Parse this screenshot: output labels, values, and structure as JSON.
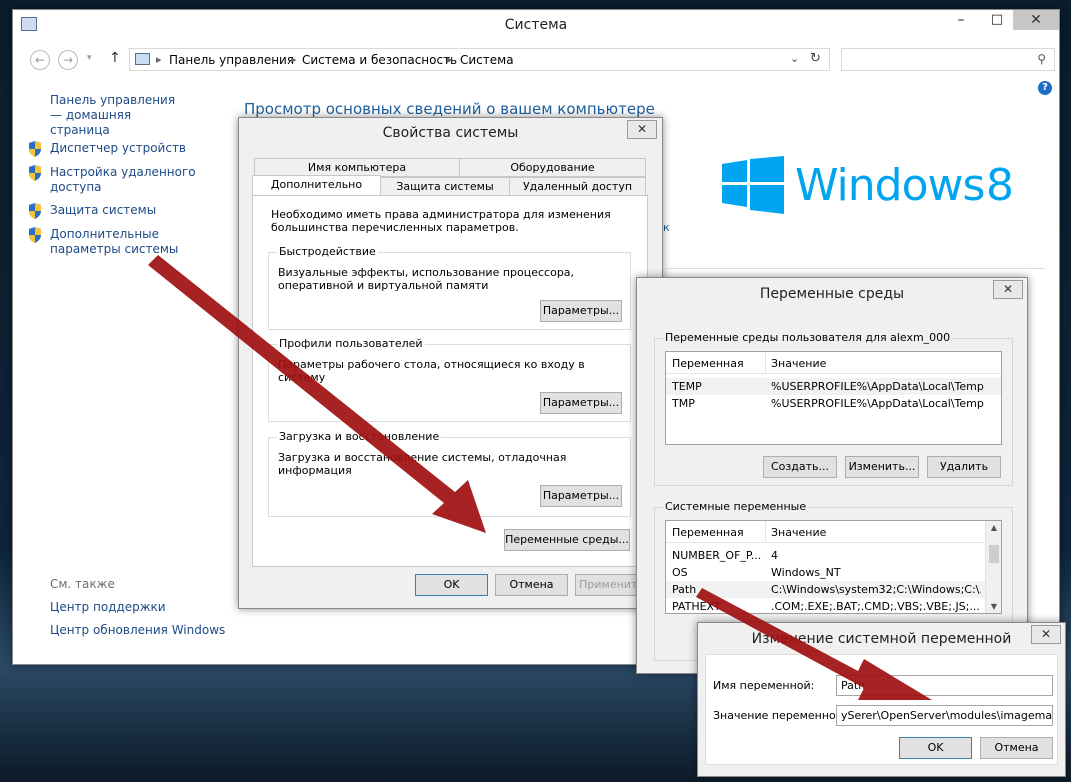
{
  "main_window": {
    "title": "Система",
    "breadcrumb": [
      "Панель управления",
      "Система и безопасность",
      "Система"
    ],
    "search_placeholder": "",
    "heading": "Просмотр основных сведений о вашем компьютере",
    "windows_logo_text": "Windows",
    "windows_version": "8",
    "partial_link": "к",
    "sidebar": {
      "home_link": "Панель управления — домашняя страница",
      "items": [
        {
          "label": "Диспетчер устройств"
        },
        {
          "label": "Настройка удаленного доступа"
        },
        {
          "label": "Защита системы"
        },
        {
          "label": "Дополнительные параметры системы"
        }
      ],
      "see_also_title": "См. также",
      "see_also": [
        "Центр поддержки",
        "Центр обновления Windows"
      ]
    }
  },
  "sys_props": {
    "title": "Свойства системы",
    "tabs_row1": [
      "Имя компьютера",
      "Оборудование"
    ],
    "tabs_row2": [
      "Дополнительно",
      "Защита системы",
      "Удаленный доступ"
    ],
    "admin_note": "Необходимо иметь права администратора для изменения большинства перечисленных параметров.",
    "performance": {
      "title": "Быстродействие",
      "desc": "Визуальные эффекты, использование процессора, оперативной и виртуальной памяти",
      "button": "Параметры..."
    },
    "profiles": {
      "title": "Профили пользователей",
      "desc": "Параметры рабочего стола, относящиеся ко входу в систему",
      "button": "Параметры..."
    },
    "startup": {
      "title": "Загрузка и восстановление",
      "desc": "Загрузка и восстановление системы, отладочная информация",
      "button": "Параметры..."
    },
    "env_button": "Переменные среды...",
    "ok": "OK",
    "cancel": "Отмена",
    "apply": "Применить"
  },
  "env_vars": {
    "title": "Переменные среды",
    "user_group_title": "Переменные среды пользователя для alexm_000",
    "col_var": "Переменная",
    "col_val": "Значение",
    "user_rows": [
      {
        "name": "TEMP",
        "value": "%USERPROFILE%\\AppData\\Local\\Temp"
      },
      {
        "name": "TMP",
        "value": "%USERPROFILE%\\AppData\\Local\\Temp"
      }
    ],
    "create": "Создать...",
    "edit": "Изменить...",
    "delete": "Удалить",
    "system_group_title": "Системные переменные",
    "system_rows": [
      {
        "name": "NUMBER_OF_P...",
        "value": "4"
      },
      {
        "name": "OS",
        "value": "Windows_NT"
      },
      {
        "name": "Path",
        "value": "C:\\Windows\\system32;C:\\Windows;C:\\..."
      },
      {
        "name": "PATHEXT",
        "value": ".COM;.EXE;.BAT;.CMD;.VBS;.VBE;.JS;..."
      }
    ]
  },
  "edit_var": {
    "title": "Изменение системной переменной",
    "name_label": "Имя переменной:",
    "name_value": "Path",
    "value_label": "Значение переменной:",
    "value_value": "ySerer\\OpenServer\\modules\\imagemagick",
    "ok": "OK",
    "cancel": "Отмена"
  },
  "colors": {
    "heading": "#1e5f9e",
    "windows_logo": "#00a4ef",
    "arrow": "#a01010"
  }
}
